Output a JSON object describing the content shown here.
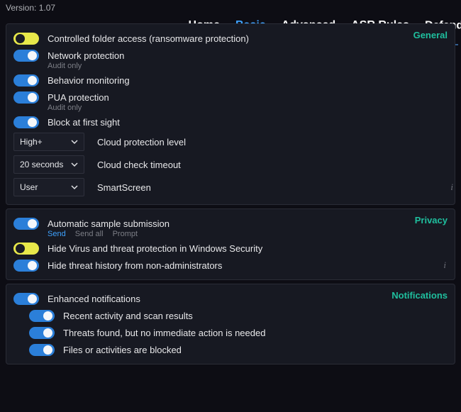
{
  "version_label": "Version: 1.07",
  "nav": {
    "home": "Home",
    "basic": "Basic",
    "advanced": "Advanced",
    "asr": "ASR Rules",
    "guard": "DefenderGuard",
    "tm": "™"
  },
  "general": {
    "title": "General",
    "controlled_folder": "Controlled folder access (ransomware protection)",
    "network_protection": "Network protection",
    "audit_only": "Audit only",
    "behavior_monitoring": "Behavior monitoring",
    "pua_protection": "PUA protection",
    "block_first_sight": "Block at first sight",
    "cloud_level_value": "High+",
    "cloud_level_label": "Cloud protection level",
    "cloud_timeout_value": "20 seconds",
    "cloud_timeout_label": "Cloud check timeout",
    "smartscreen_value": "User",
    "smartscreen_label": "SmartScreen"
  },
  "privacy": {
    "title": "Privacy",
    "auto_sample": "Automatic sample submission",
    "send": "Send",
    "send_all": "Send all",
    "prompt": "Prompt",
    "hide_virus": "Hide Virus and threat protection in Windows Security",
    "hide_history": "Hide threat history from non-administrators"
  },
  "notifications": {
    "title": "Notifications",
    "enhanced": "Enhanced notifications",
    "recent": "Recent activity and scan results",
    "threats_found": "Threats found, but no immediate action is needed",
    "blocked": "Files or activities are blocked"
  }
}
